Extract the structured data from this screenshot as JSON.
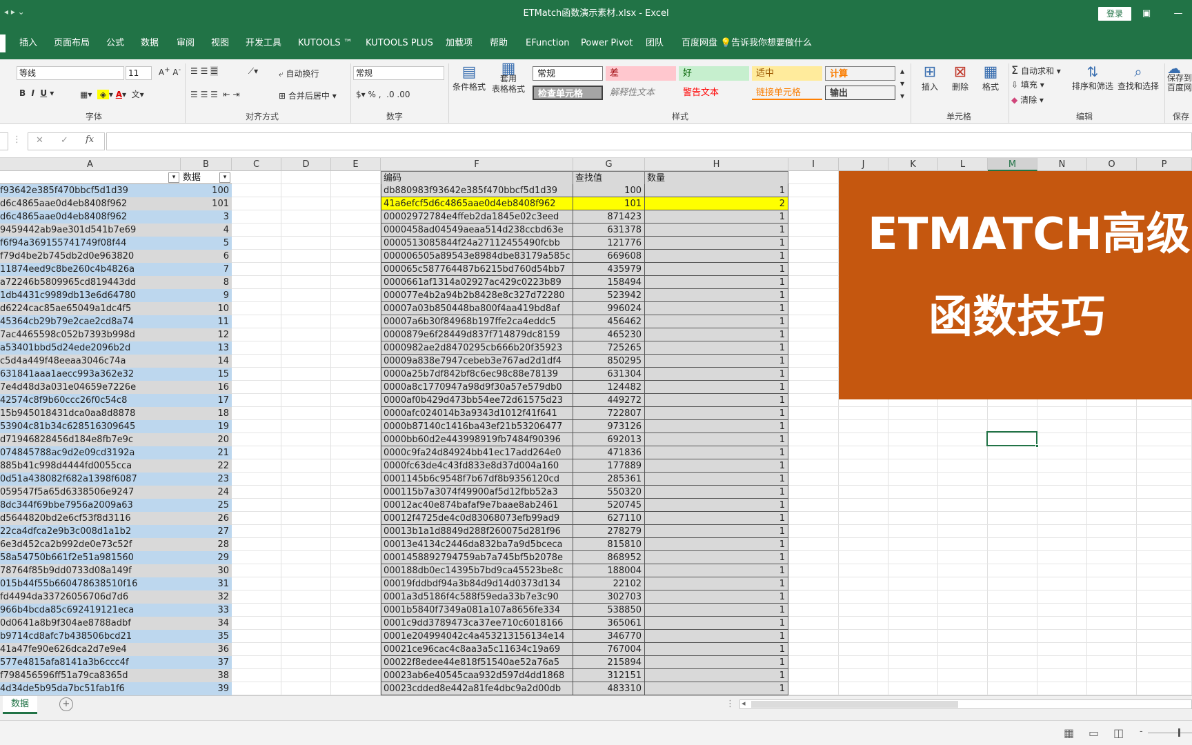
{
  "window": {
    "title": "ETMatch函数演示素材.xlsx  -  Excel",
    "login": "登录"
  },
  "tabs": [
    "插入",
    "页面布局",
    "公式",
    "数据",
    "审阅",
    "视图",
    "开发工具",
    "KUTOOLS ™",
    "KUTOOLS PLUS",
    "加载项",
    "帮助",
    "EFunction",
    "Power Pivot",
    "团队",
    "百度网盘",
    "告诉我你想要做什么"
  ],
  "ribbon": {
    "font_name": "等线",
    "font_size": "11",
    "wrap_text": "自动换行",
    "merge_center": "合并后居中",
    "number_format": "常规",
    "conditional_format": "条件格式",
    "table_format": "套用\n表格格式",
    "styles": {
      "normal": "常规",
      "bad": "差",
      "good": "好",
      "neutral": "适中",
      "calc": "计算",
      "check": "检查单元格",
      "explain": "解释性文本",
      "warning": "警告文本",
      "linked": "链接单元格",
      "output": "输出"
    },
    "insert": "插入",
    "delete": "删除",
    "format": "格式",
    "autosum": "自动求和",
    "fill": "填充",
    "clear": "清除",
    "sort_filter": "排序和筛选",
    "find_select": "查找和选择",
    "save_baidu": "保存到\n百度网",
    "groups": {
      "font": "字体",
      "align": "对齐方式",
      "number": "数字",
      "styles": "样式",
      "cells": "单元格",
      "edit": "编辑",
      "save": "保存"
    }
  },
  "formula": {
    "fx": "fx",
    "cancel": "✕",
    "confirm": "✓"
  },
  "columns": [
    "A",
    "B",
    "C",
    "D",
    "E",
    "F",
    "G",
    "H",
    "I",
    "J",
    "K",
    "L",
    "M",
    "N",
    "O",
    "P"
  ],
  "selected_column": "M",
  "left_table": {
    "headers": {
      "a": "",
      "b": "数据"
    },
    "rows": [
      [
        "f93642e385f470bbcf5d1d39",
        "100"
      ],
      [
        "d6c4865aae0d4eb8408f962",
        "101"
      ],
      [
        "d6c4865aae0d4eb8408f962",
        "3"
      ],
      [
        "9459442ab9ae301d541b7e69",
        "4"
      ],
      [
        "f6f94a369155741749f08f44",
        "5"
      ],
      [
        "f79d4be2b745db2d0e963820",
        "6"
      ],
      [
        "11874eed9c8be260c4b4826a",
        "7"
      ],
      [
        "a72246b5809965cd819443dd",
        "8"
      ],
      [
        "1db4431c9989db13e6d64780",
        "9"
      ],
      [
        "d6224cac85ae65049a1dc4f5",
        "10"
      ],
      [
        "45364cb29b79e2cae2cd8a74",
        "11"
      ],
      [
        "7ac4465598c052b7393b998d",
        "12"
      ],
      [
        "a53401bbd5d24ede2096b2d",
        "13"
      ],
      [
        "c5d4a449f48eeaa3046c74a",
        "14"
      ],
      [
        "631841aaa1aecc993a362e32",
        "15"
      ],
      [
        "7e4d48d3a031e04659e7226e",
        "16"
      ],
      [
        "42574c8f9b60ccc26f0c54c8",
        "17"
      ],
      [
        "15b945018431dca0aa8d8878",
        "18"
      ],
      [
        "53904c81b34c628516309645",
        "19"
      ],
      [
        "d71946828456d184e8fb7e9c",
        "20"
      ],
      [
        "074845788ac9d2e09cd3192a",
        "21"
      ],
      [
        "885b41c998d4444fd0055cca",
        "22"
      ],
      [
        "0d51a438082f682a1398f6087",
        "23"
      ],
      [
        "059547f5a65d6338506e9247",
        "24"
      ],
      [
        "8dc344f69bbe7956a2009a63",
        "25"
      ],
      [
        "d5644820bd2e6cf53f8d3116",
        "26"
      ],
      [
        "22ca4dfca2e9b3c008d1a1b2",
        "27"
      ],
      [
        "6e3d452ca2b992de0e73c52f",
        "28"
      ],
      [
        "58a54750b661f2e51a981560",
        "29"
      ],
      [
        "78764f85b9dd0733d08a149f",
        "30"
      ],
      [
        "015b44f55b660478638510f16",
        "31"
      ],
      [
        "fd4494da33726056706d7d6",
        "32"
      ],
      [
        "966b4bcda85c692419121eca",
        "33"
      ],
      [
        "0d0641a8b9f304ae8788adbf",
        "34"
      ],
      [
        "b9714cd8afc7b438506bcd21",
        "35"
      ],
      [
        "41a47fe90e626dca2d7e9e4",
        "36"
      ],
      [
        "577e4815afa8141a3b6ccc4f",
        "37"
      ],
      [
        "f798456596ff51a79ca8365d",
        "38"
      ],
      [
        "4d34de5b95da7bc51fab1f6",
        "39"
      ]
    ]
  },
  "right_table": {
    "headers": {
      "f": "编码",
      "g": "查找值",
      "h": "数量"
    },
    "rows": [
      [
        "db880983f93642e385f470bbcf5d1d39",
        "100",
        "1"
      ],
      [
        "41a6efcf5d6c4865aae0d4eb8408f962",
        "101",
        "2"
      ],
      [
        "00002972784e4ffeb2da1845e02c3eed",
        "871423",
        "1"
      ],
      [
        "0000458ad04549aeaa514d238ccbd63e",
        "631378",
        "1"
      ],
      [
        "0000513085844f24a27112455490fcbb",
        "121776",
        "1"
      ],
      [
        "000006505a89543e8984dbe83179a585c",
        "669608",
        "1"
      ],
      [
        "000065c587764487b6215bd760d54bb7",
        "435979",
        "1"
      ],
      [
        "0000661af1314a02927ac429c0223b89",
        "158494",
        "1"
      ],
      [
        "000077e4b2a94b2b8428e8c327d72280",
        "523942",
        "1"
      ],
      [
        "00007a03b850448ba800f4aa419bd8af",
        "996024",
        "1"
      ],
      [
        "00007a6b30f84968b197ffe2ca4eddc5",
        "456462",
        "1"
      ],
      [
        "0000879e6f28449d837f714879dc8159",
        "465230",
        "1"
      ],
      [
        "0000982ae2d8470295cb666b20f35923",
        "725265",
        "1"
      ],
      [
        "00009a838e7947cebeb3e767ad2d1df4",
        "850295",
        "1"
      ],
      [
        "0000a25b7df842bf8c6ec98c88e78139",
        "631304",
        "1"
      ],
      [
        "0000a8c1770947a98d9f30a57e579db0",
        "124482",
        "1"
      ],
      [
        "0000af0b429d473bb54ee72d61575d23",
        "449272",
        "1"
      ],
      [
        "0000afc024014b3a9343d1012f41f641",
        "722807",
        "1"
      ],
      [
        "0000b87140c1416ba43ef21b53206477",
        "973126",
        "1"
      ],
      [
        "0000bb60d2e443998919fb7484f90396",
        "692013",
        "1"
      ],
      [
        "0000c9fa24d84924bb41ec17add264e0",
        "471836",
        "1"
      ],
      [
        "0000fc63de4c43fd833e8d37d004a160",
        "177889",
        "1"
      ],
      [
        "0001145b6c9548f7b67df8b9356120cd",
        "285361",
        "1"
      ],
      [
        "000115b7a3074f49900af5d12fbb52a3",
        "550320",
        "1"
      ],
      [
        "00012ac40e874bafaf9e7baae8ab2461",
        "520745",
        "1"
      ],
      [
        "00012f4725de4c0d83068073efb99ad9",
        "627110",
        "1"
      ],
      [
        "00013b1a1d8849d288f260075d281f96",
        "278279",
        "1"
      ],
      [
        "00013e4134c2446da832ba7a9d5bceca",
        "815810",
        "1"
      ],
      [
        "0001458892794759ab7a745bf5b2078e",
        "868952",
        "1"
      ],
      [
        "000188db0ec14395b7bd9ca45523be8c",
        "188004",
        "1"
      ],
      [
        "00019fddbdf94a3b84d9d14d0373d134",
        "22102",
        "1"
      ],
      [
        "0001a3d5186f4c588f59eda33b7e3c90",
        "302703",
        "1"
      ],
      [
        "0001b5840f7349a081a107a8656fe334",
        "538850",
        "1"
      ],
      [
        "0001c9dd3789473ca37ee710c6018166",
        "365061",
        "1"
      ],
      [
        "0001e204994042c4a453213156134e14",
        "346770",
        "1"
      ],
      [
        "00021ce96cac4c8aa3a5c11634c19a69",
        "767004",
        "1"
      ],
      [
        "00022f8edee44e818f51540ae52a76a5",
        "215894",
        "1"
      ],
      [
        "00023ab6e40545caa932d597d4dd1868",
        "312151",
        "1"
      ],
      [
        "00023cdded8e442a81fe4dbc9a2d00db",
        "483310",
        "1"
      ]
    ]
  },
  "banner": {
    "line1": "ETMATCH高级",
    "line2": "函数技巧"
  },
  "sheet": {
    "active": "数据"
  },
  "colors": {
    "excel_green": "#217346",
    "banner": "#c5570f",
    "highlight": "#ffff00",
    "band_blue": "#bdd7ee",
    "band_gray": "#d9d9d9"
  }
}
